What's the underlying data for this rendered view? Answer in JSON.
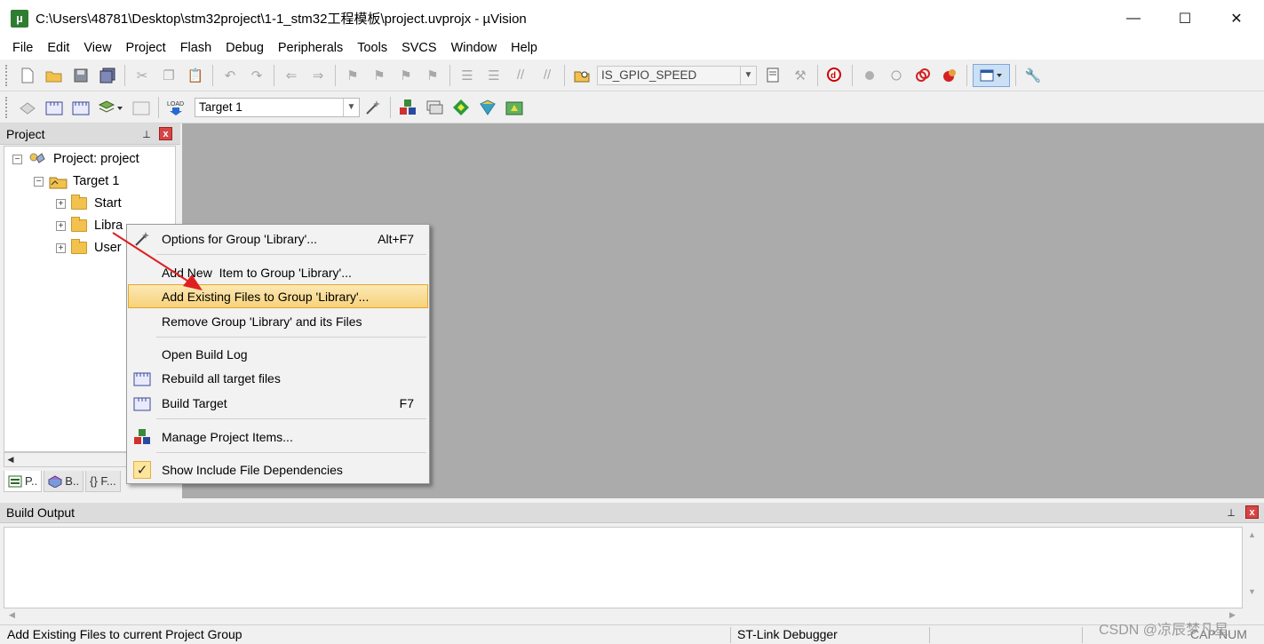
{
  "window": {
    "title": "C:\\Users\\48781\\Desktop\\stm32project\\1-1_stm32工程模板\\project.uvprojx - µVision",
    "app_icon": "µ",
    "minimize": "—",
    "maximize": "☐",
    "close": "✕"
  },
  "menu": [
    "File",
    "Edit",
    "View",
    "Project",
    "Flash",
    "Debug",
    "Peripherals",
    "Tools",
    "SVCS",
    "Window",
    "Help"
  ],
  "toolbar1": {
    "find_combo_value": "IS_GPIO_SPEED",
    "icons": [
      "new-file-icon",
      "open-file-icon",
      "save-icon",
      "save-all-icon",
      "cut-icon",
      "copy-icon",
      "paste-icon",
      "undo-icon",
      "redo-icon",
      "nav-back-icon",
      "nav-forward-icon",
      "bookmark-icon",
      "bookmark-prev-icon",
      "bookmark-next-icon",
      "bookmark-clear-icon",
      "indent-icon",
      "unindent-icon",
      "comment-icon",
      "uncomment-icon",
      "find-in-files-icon",
      "find-icon",
      "incremental-find-icon",
      "debug-start-icon",
      "breakpoint-insert-icon",
      "breakpoint-enable-icon",
      "breakpoint-disable-icon",
      "breakpoint-kill-icon",
      "window-layout-icon",
      "configure-icon"
    ]
  },
  "toolbar2": {
    "target_combo_value": "Target 1"
  },
  "project_panel": {
    "title": "Project",
    "pin": "⊥",
    "close": "x",
    "tree": {
      "root": "Project: project",
      "target": "Target 1",
      "groups": [
        "Start",
        "Libra",
        "User"
      ]
    },
    "tabs": [
      "P..",
      "B..",
      "{} F..."
    ]
  },
  "context_menu": {
    "items": [
      {
        "label": "Options for Group 'Library'...",
        "shortcut": "Alt+F7",
        "icon": "options-wand-icon"
      },
      {
        "label": "Add New  Item to Group 'Library'...",
        "shortcut": "",
        "icon": ""
      },
      {
        "label": "Add Existing Files to Group 'Library'...",
        "shortcut": "",
        "icon": "",
        "highlighted": true
      },
      {
        "label": "Remove Group 'Library' and its Files",
        "shortcut": "",
        "icon": ""
      },
      {
        "label": "Open Build Log",
        "shortcut": "",
        "icon": ""
      },
      {
        "label": "Rebuild all target files",
        "shortcut": "",
        "icon": "rebuild-icon"
      },
      {
        "label": "Build Target",
        "shortcut": "F7",
        "icon": "build-icon"
      },
      {
        "label": "Manage Project Items...",
        "shortcut": "",
        "icon": "manage-items-icon"
      },
      {
        "label": "Show Include File Dependencies",
        "shortcut": "",
        "icon": "checkmark-icon",
        "checked": true
      }
    ]
  },
  "build_output": {
    "title": "Build Output",
    "pin": "⊥",
    "close": "x"
  },
  "status": {
    "message": "Add Existing Files to current Project Group",
    "debugger": "ST-Link Debugger",
    "caps": "CAP",
    "num": "NUM"
  },
  "watermark": "CSDN @凉辰梦凡星",
  "colors": {
    "editor_bg": "#ababab",
    "highlight": "#f7d27a",
    "arrow": "#e02020"
  }
}
